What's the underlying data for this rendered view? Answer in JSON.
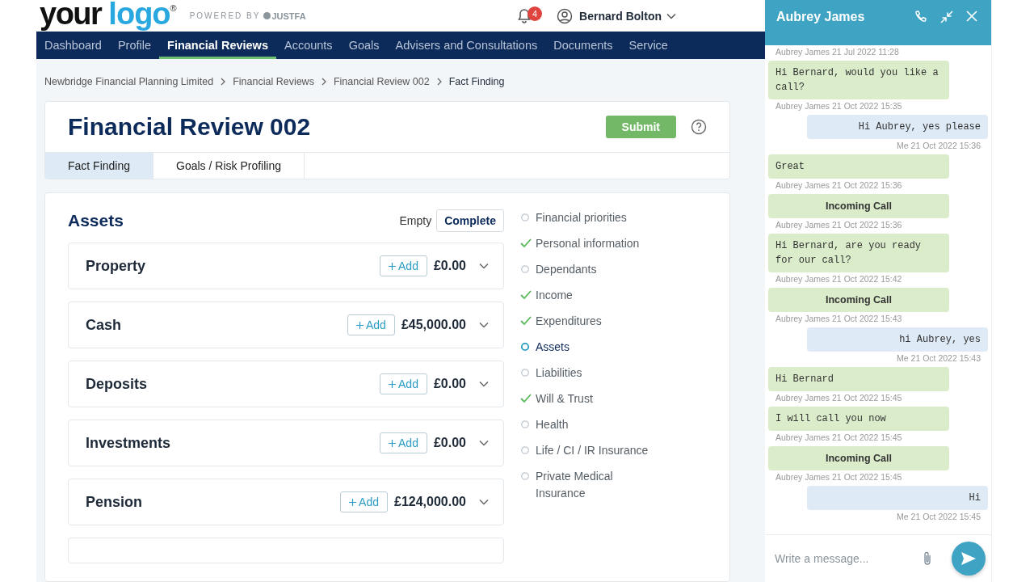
{
  "header": {
    "logo_dark": "your",
    "logo_light": "logo",
    "logo_mark": "®",
    "powered_by": "POWERED BY",
    "brand": "JUSTFA",
    "notification_count": "4",
    "user_name": "Bernard Bolton"
  },
  "nav": [
    {
      "label": "Dashboard",
      "selected": false
    },
    {
      "label": "Profile",
      "selected": false
    },
    {
      "label": "Financial Reviews",
      "selected": true
    },
    {
      "label": "Accounts",
      "selected": false
    },
    {
      "label": "Goals",
      "selected": false
    },
    {
      "label": "Advisers and Consultations",
      "selected": false
    },
    {
      "label": "Documents",
      "selected": false
    },
    {
      "label": "Service",
      "selected": false
    }
  ],
  "breadcrumb": [
    "Newbridge Financial Planning Limited",
    "Financial Reviews",
    "Financial Review 002",
    "Fact Finding"
  ],
  "review": {
    "title": "Financial Review 002",
    "submit": "Submit",
    "tabs": [
      {
        "label": "Fact Finding",
        "selected": true
      },
      {
        "label": "Goals / Risk Profiling",
        "selected": false
      }
    ]
  },
  "assets": {
    "title": "Assets",
    "status_label": "Empty",
    "complete_button": "Complete",
    "sections": [
      {
        "name": "Property",
        "add": "Add",
        "total": "£0.00"
      },
      {
        "name": "Cash",
        "add": "Add",
        "total": "£45,000.00"
      },
      {
        "name": "Deposits",
        "add": "Add",
        "total": "£0.00"
      },
      {
        "name": "Investments",
        "add": "Add",
        "total": "£0.00"
      },
      {
        "name": "Pension",
        "add": "Add",
        "total": "£124,000.00"
      }
    ]
  },
  "checklist": [
    {
      "label": "Financial priorities",
      "done": false,
      "selected": false
    },
    {
      "label": "Personal information",
      "done": true,
      "selected": false
    },
    {
      "label": "Dependants",
      "done": false,
      "selected": false
    },
    {
      "label": "Income",
      "done": true,
      "selected": false
    },
    {
      "label": "Expenditures",
      "done": true,
      "selected": false
    },
    {
      "label": "Assets",
      "done": false,
      "selected": true
    },
    {
      "label": "Liabilities",
      "done": false,
      "selected": false
    },
    {
      "label": "Will & Trust",
      "done": true,
      "selected": false
    },
    {
      "label": "Health",
      "done": false,
      "selected": false
    },
    {
      "label": "Life / CI / IR Insurance",
      "done": false,
      "selected": false
    },
    {
      "label": "Private Medical Insurance",
      "done": false,
      "selected": false
    }
  ],
  "chat": {
    "title": "Aubrey James",
    "top_meta": "Aubrey James 21 Jul 2022 11:28",
    "messages": [
      {
        "kind": "in",
        "text": "Hi Bernard, would you like a call?",
        "meta": "Aubrey James 21 Oct 2022 15:35"
      },
      {
        "kind": "out",
        "text": "Hi Aubrey, yes please",
        "meta": "Me 21 Oct 2022 15:36"
      },
      {
        "kind": "in",
        "text": "Great",
        "meta": "Aubrey James 21 Oct 2022 15:36"
      },
      {
        "kind": "call",
        "text": "Incoming Call",
        "meta": "Aubrey James 21 Oct 2022 15:36"
      },
      {
        "kind": "in",
        "text": "Hi Bernard, are you ready for our call?",
        "meta": "Aubrey James 21 Oct 2022 15:42"
      },
      {
        "kind": "call",
        "text": "Incoming Call",
        "meta": "Aubrey James 21 Oct 2022 15:43"
      },
      {
        "kind": "out",
        "text": "hi Aubrey, yes",
        "meta": "Me 21 Oct 2022 15:43"
      },
      {
        "kind": "in",
        "text": "Hi Bernard",
        "meta": "Aubrey James 21 Oct 2022 15:45"
      },
      {
        "kind": "in",
        "text": "I will call you now",
        "meta": "Aubrey James 21 Oct 2022 15:45"
      },
      {
        "kind": "call",
        "text": "Incoming Call",
        "meta": "Aubrey James 21 Oct 2022 15:45"
      },
      {
        "kind": "out",
        "text": "Hi",
        "meta": "Me 21 Oct 2022 15:45"
      }
    ],
    "placeholder": "Write a message..."
  }
}
